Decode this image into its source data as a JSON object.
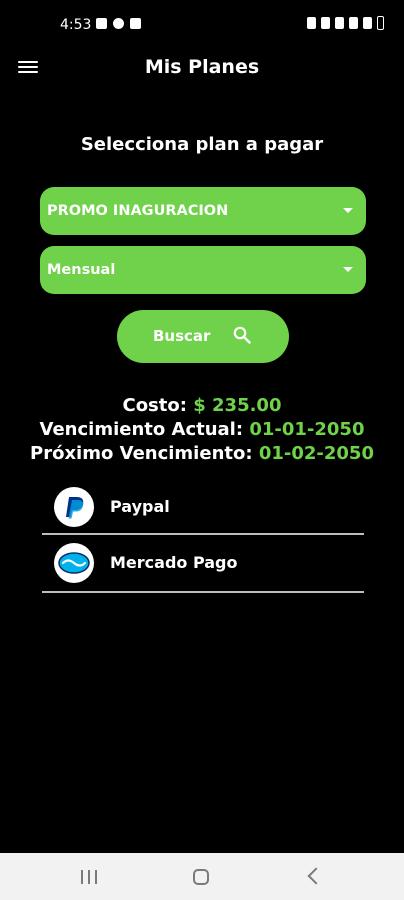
{
  "status_bar": {
    "time": "4:53"
  },
  "app_bar": {
    "title": "Mis Planes"
  },
  "subtitle": "Selecciona plan a pagar",
  "plan_select": {
    "selected": "PROMO INAGURACION"
  },
  "period_select": {
    "selected": "Mensual"
  },
  "search_button": {
    "label": "Buscar"
  },
  "details": {
    "cost_label": "Costo:",
    "cost_value": "$ 235.00",
    "current_label": "Vencimiento Actual:",
    "current_value": "01-01-2050",
    "next_label": "Próximo Vencimiento:",
    "next_value": "01-02-2050"
  },
  "payment_methods": [
    {
      "name": "Paypal",
      "icon": "paypal-icon"
    },
    {
      "name": "Mercado Pago",
      "icon": "mercado-pago-icon"
    }
  ],
  "colors": {
    "accent": "#6fd24a",
    "background": "#000000"
  }
}
